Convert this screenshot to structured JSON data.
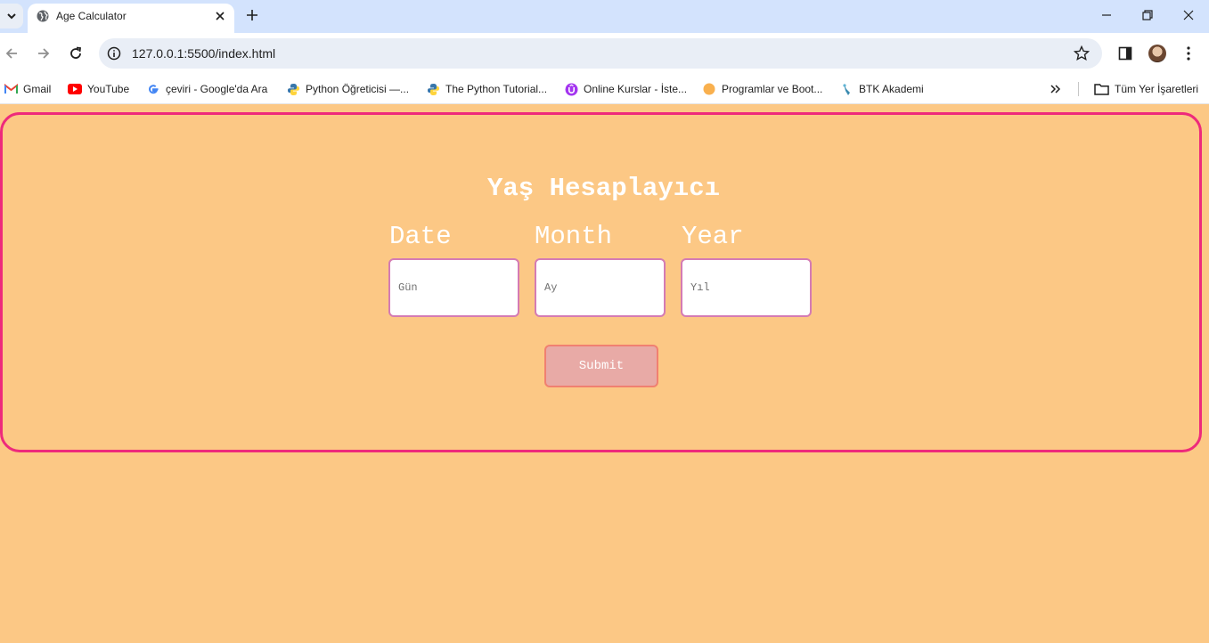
{
  "browser": {
    "tab": {
      "title": "Age Calculator"
    },
    "url": "127.0.0.1:5500/index.html",
    "bookmarks": [
      {
        "label": "Gmail",
        "icon": "gmail-icon"
      },
      {
        "label": "YouTube",
        "icon": "youtube-icon"
      },
      {
        "label": "çeviri - Google'da Ara",
        "icon": "google-icon"
      },
      {
        "label": "Python Öğreticisi —...",
        "icon": "python-icon"
      },
      {
        "label": "The Python Tutorial...",
        "icon": "python-icon"
      },
      {
        "label": "Online Kurslar - İste...",
        "icon": "udemy-icon"
      },
      {
        "label": "Programlar ve Boot...",
        "icon": "circle-icon"
      },
      {
        "label": "BTK Akademi",
        "icon": "btk-icon"
      }
    ],
    "all_bookmarks": "Tüm Yer İşaretleri"
  },
  "app": {
    "heading": "Yaş Hesaplayıcı",
    "fields": [
      {
        "label": "Date",
        "placeholder": "Gün"
      },
      {
        "label": "Month",
        "placeholder": "Ay"
      },
      {
        "label": "Year",
        "placeholder": "Yıl"
      }
    ],
    "submit_label": "Submit"
  },
  "colors": {
    "background": "#fcc885",
    "card_border": "#ee2a7b",
    "input_border": "#d47bb4",
    "submit_bg": "#e8aaa6",
    "submit_border": "#f08071"
  }
}
